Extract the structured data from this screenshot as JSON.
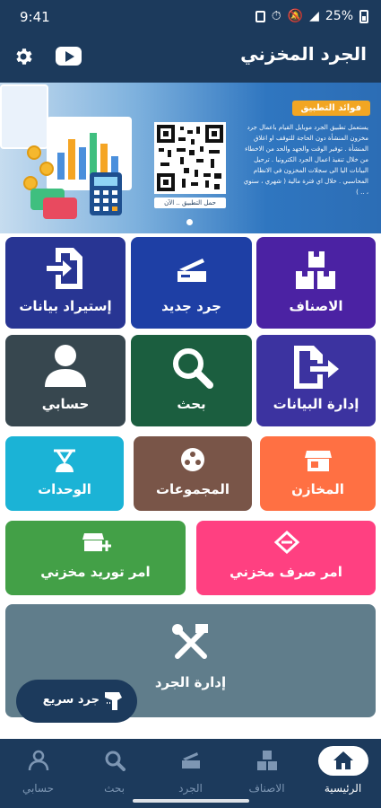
{
  "status": {
    "time": "9:41",
    "battery": "25%"
  },
  "header": {
    "title": "الجرد المخزني",
    "settings_icon": "gear-icon",
    "youtube_icon": "youtube-icon"
  },
  "banner": {
    "tag": "فوائد التطبيق",
    "text": "يستعمل تطبيق الجرد موبايل القيام باعمال جرد مخزون المنشأة دون الحاجة للتوقف او اغلاق المنشأة . توفير الوقت والجهد والحد من الاخطاء من خلال تنفيذ اعمال الجرد الكترونيا . ترحيل البيانات اليا الى سجلات المخزون في الانظام المحاسبي . خلال اي فترة مالية ( شهري ، سنوي ، .. )",
    "qr_caption": "حمل التطبيق .. الآن"
  },
  "tiles": {
    "items": "الاصناف",
    "new_count": "جرد جديد",
    "import_data": "إستيراد بيانات",
    "data_management": "إدارة البيانات",
    "search": "بحث",
    "my_account": "حسابي",
    "warehouses": "المخازن",
    "groups": "المجموعات",
    "units": "الوحدات",
    "issue_order": "امر صرف مخزني",
    "supply_order": "امر توريد مخزني",
    "count_management": "إدارة الجرد"
  },
  "quick_count": {
    "label": "جرد سريع"
  },
  "nav": {
    "home": "الرئيسية",
    "items": "الاصناف",
    "count": "الجرد",
    "search": "بحث",
    "account": "حسابي"
  },
  "colors": {
    "primary": "#1c3a5c",
    "purple": "#4b22a3",
    "blue": "#1e3fa5",
    "navy_tile": "#283593",
    "dark_slate": "#37474f",
    "dark_green": "#1b5e3f",
    "indigo_tile": "#3c33a0",
    "orange": "#ff7043",
    "brown": "#795548",
    "cyan": "#1bb3d6",
    "pink": "#ff4081",
    "green": "#43a047",
    "grey_blue": "#607d8b"
  }
}
